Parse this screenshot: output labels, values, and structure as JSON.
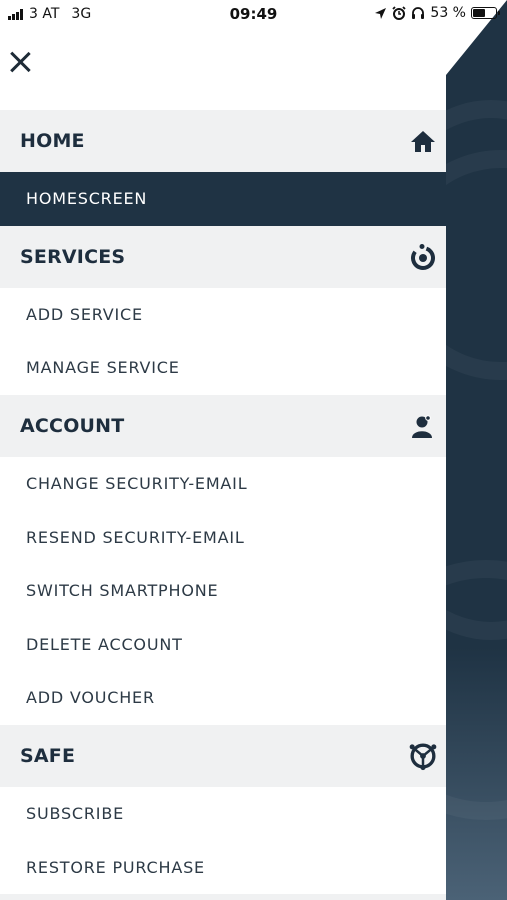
{
  "status_bar": {
    "carrier": "3 AT",
    "network": "3G",
    "time": "09:49",
    "battery_text": "53 %",
    "battery_level": 0.53
  },
  "sections": [
    {
      "title": "HOME",
      "icon": "home-icon",
      "items": [
        {
          "label": "HOMESCREEN",
          "active": true
        }
      ]
    },
    {
      "title": "SERVICES",
      "icon": "services-icon",
      "items": [
        {
          "label": "ADD SERVICE"
        },
        {
          "label": "MANAGE SERVICE"
        }
      ]
    },
    {
      "title": "ACCOUNT",
      "icon": "account-icon",
      "items": [
        {
          "label": "CHANGE SECURITY-EMAIL"
        },
        {
          "label": "RESEND SECURITY-EMAIL"
        },
        {
          "label": "SWITCH SMARTPHONE"
        },
        {
          "label": "DELETE ACCOUNT"
        },
        {
          "label": "ADD VOUCHER"
        }
      ]
    },
    {
      "title": "SAFE",
      "icon": "safe-icon",
      "items": [
        {
          "label": "SUBSCRIBE"
        },
        {
          "label": "RESTORE PURCHASE"
        }
      ]
    }
  ],
  "colors": {
    "dark_navy": "#1f3344",
    "header_bg": "#f0f1f2",
    "text": "#2d3a46"
  }
}
